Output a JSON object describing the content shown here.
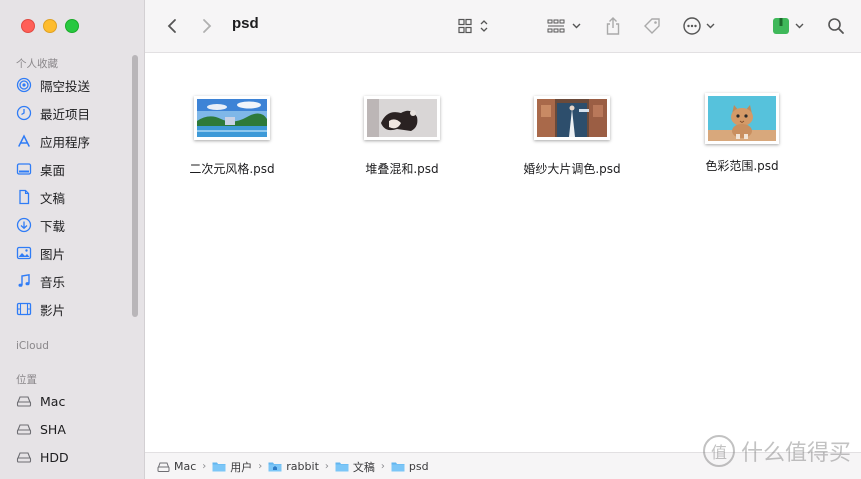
{
  "window": {
    "folder_title": "psd"
  },
  "sidebar": {
    "favorites_title": "个人收藏",
    "favorites": [
      {
        "label": "隔空投送",
        "icon": "airdrop-icon"
      },
      {
        "label": "最近项目",
        "icon": "clock-icon"
      },
      {
        "label": "应用程序",
        "icon": "applications-icon"
      },
      {
        "label": "桌面",
        "icon": "desktop-icon"
      },
      {
        "label": "文稿",
        "icon": "document-icon"
      },
      {
        "label": "下载",
        "icon": "download-icon"
      },
      {
        "label": "图片",
        "icon": "pictures-icon"
      },
      {
        "label": "音乐",
        "icon": "music-icon"
      },
      {
        "label": "影片",
        "icon": "movies-icon"
      }
    ],
    "icloud_title": "iCloud",
    "locations_title": "位置",
    "locations": [
      {
        "label": "Mac",
        "icon": "disk-icon"
      },
      {
        "label": "SHA",
        "icon": "disk-icon"
      },
      {
        "label": "HDD",
        "icon": "disk-icon"
      }
    ]
  },
  "files": [
    {
      "name": "二次元风格.psd"
    },
    {
      "name": "堆叠混和.psd"
    },
    {
      "name": "婚纱大片调色.psd"
    },
    {
      "name": "色彩范围.psd"
    }
  ],
  "pathbar": [
    {
      "label": "Mac"
    },
    {
      "label": "用户"
    },
    {
      "label": "rabbit"
    },
    {
      "label": "文稿"
    },
    {
      "label": "psd"
    }
  ],
  "watermark": {
    "text": "什么值得买",
    "glyph": "值"
  },
  "colors": {
    "accent": "#2f7cf6",
    "sidebar_bg": "#e6e3e6",
    "toolbar_bg": "#f6f5f6"
  }
}
